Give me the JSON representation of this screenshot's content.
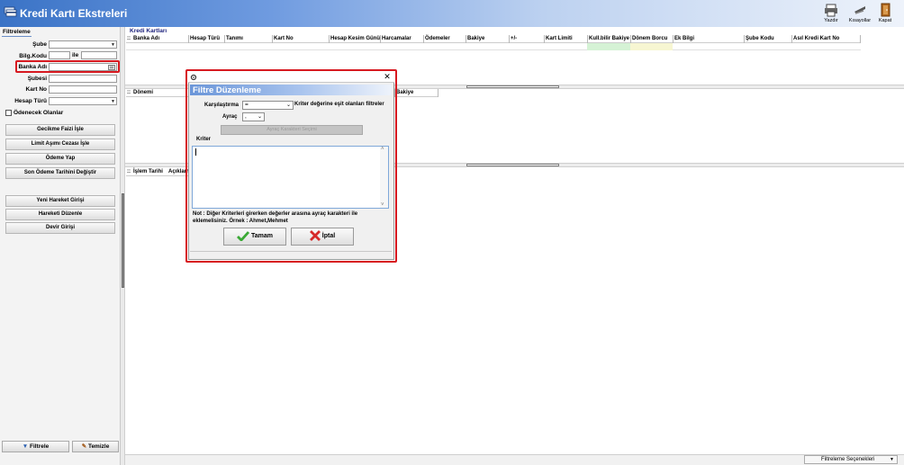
{
  "window": {
    "title": "Kredi Kartı Ekstreleri"
  },
  "toolbar": [
    {
      "label": "Yazdır",
      "icon": "printer-icon"
    },
    {
      "label": "Kısayollar",
      "icon": "shortcuts-icon"
    },
    {
      "label": "Kapat",
      "icon": "exit-door-icon"
    }
  ],
  "filter_panel": {
    "tab": "Filtreleme",
    "sube_label": "Şube",
    "bilgkodu_label": "Bilg.Kodu",
    "ile_label": "ile",
    "banka_label": "Banka Adı",
    "subesi_label": "Şubesi",
    "kartno_label": "Kart No",
    "hesapturu_label": "Hesap Türü",
    "odenecek_label": "Ödenecek Olanlar",
    "action_buttons": [
      "Gecikme Faizi İşle",
      "Limit Aşımı Cezası İşle",
      "Ödeme Yap",
      "Son Ödeme Tarihini Değiştir"
    ],
    "action_buttons2": [
      "Yeni Hareket Girişi",
      "Hareketi Düzenle",
      "Devir Girişi"
    ],
    "filtrele_label": "Filtrele",
    "temizle_label": "Temizle"
  },
  "grid_kartlar": {
    "title": "Kredi Kartları",
    "columns": [
      "Banka Adı",
      "Hesap Türü",
      "Tanımı",
      "Kart No",
      "Hesap Kesim Günü",
      "Harcamalar",
      "Ödemeler",
      "Bakiye",
      "+/-",
      "Kart Limiti",
      "Kull.bilir Bakiye",
      "Dönem Borcu",
      "Ek Bilgi",
      "Şube Kodu",
      "Asıl Kredi Kart No"
    ]
  },
  "grid_donem": {
    "columns": [
      "Dönemi",
      "Bakiye"
    ]
  },
  "grid_hareket": {
    "columns": [
      "İşlem Tarihi",
      "Açıklama"
    ]
  },
  "dialog": {
    "title": "Filtre Düzenleme",
    "karsilastirma_label": "Karşılaştırma",
    "karsilastirma_value": "=",
    "karsilastirma_desc": "Kriter değerine eşit olanları filtreler",
    "ayrac_label": "Ayraç",
    "ayrac_value": ",",
    "ayrac_button": "Ayraç Karakteri Seçimi",
    "kriter_label": "Kriter",
    "note": "Not : Diğer Kriterleri girerken değerler arasına ayraç karakteri ile eklemelisiniz. Örnek : Ahmet,Mehmet",
    "ok_label": "Tamam",
    "cancel_label": "İptal"
  },
  "status": {
    "filter_options": "Filtreleme Seçenekleri"
  },
  "colors": {
    "highlight": "#d71920",
    "title_gradient_start": "#3a73c6",
    "ok_check": "#3aa935",
    "cancel_x": "#d62a2a"
  }
}
